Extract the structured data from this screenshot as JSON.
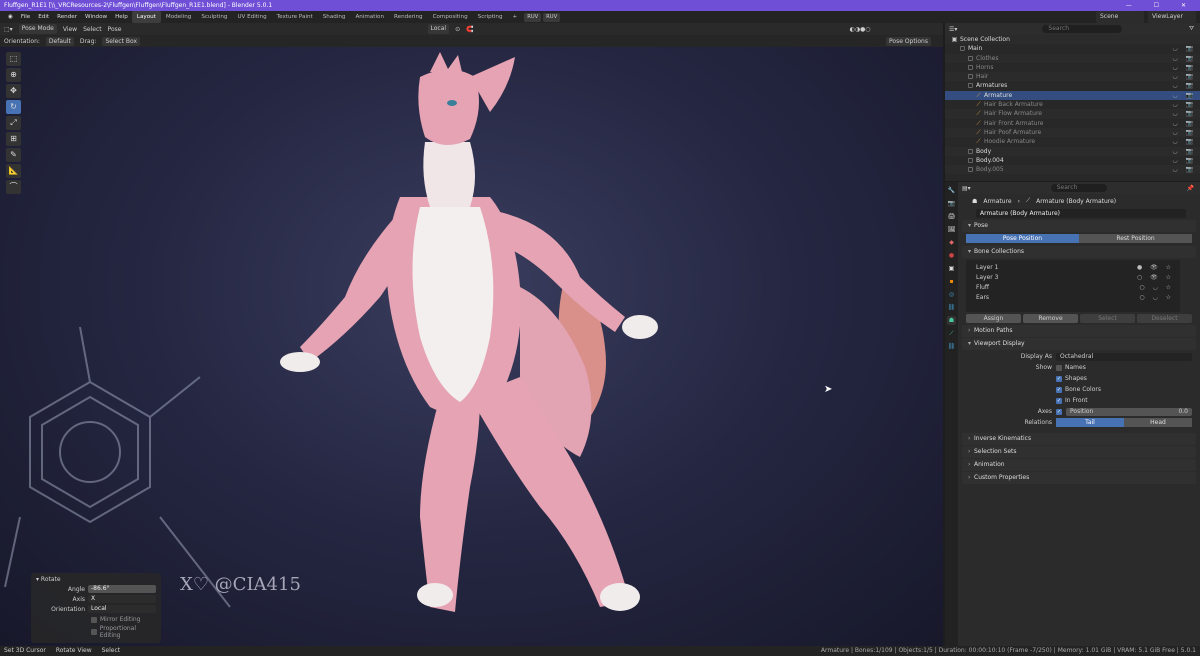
{
  "window": {
    "title": "Fluffgen_R1E1 [\\\\_VRCResources-2\\Fluffgen\\Fluffgen\\Fluffgen_R1E1.blend] - Blender 5.0.1",
    "controls": "—  ☐  ✕"
  },
  "menu": {
    "items": [
      "File",
      "Edit",
      "Render",
      "Window",
      "Help"
    ],
    "workspaces": [
      "Layout",
      "Modeling",
      "Sculpting",
      "UV Editing",
      "Texture Paint",
      "Shading",
      "Animation",
      "Rendering",
      "Compositing",
      "Scripting"
    ],
    "ruv1": "RUV",
    "ruv2": "RUV",
    "scene": "Scene",
    "view_layer": "ViewLayer"
  },
  "viewport_header": {
    "mode": "Pose Mode",
    "view": "View",
    "select": "Select",
    "pose": "Pose",
    "orientation_global": "Local",
    "pose_options": "Pose Options"
  },
  "tool_settings": {
    "orientation_label": "Orientation:",
    "orientation_value": "Default",
    "drag_label": "Drag:",
    "drag_value": "Select Box"
  },
  "rotate_panel": {
    "title": "Rotate",
    "angle_label": "Angle",
    "angle_value": "-86.6°",
    "axis_label": "Axis",
    "axis_value": "X",
    "orientation_label": "Orientation",
    "orientation_value": "Local",
    "mirror": "Mirror Editing",
    "proportional": "Proportional Editing"
  },
  "watermark": "X♡ @CIA415",
  "outliner": {
    "search_placeholder": "Search",
    "rows": [
      {
        "name": "Scene Collection",
        "indent": 0,
        "dim": false
      },
      {
        "name": "Main",
        "indent": 1,
        "dim": false
      },
      {
        "name": "Clothes",
        "indent": 2,
        "dim": true
      },
      {
        "name": "Horns",
        "indent": 2,
        "dim": true
      },
      {
        "name": "Hair",
        "indent": 2,
        "dim": true
      },
      {
        "name": "Armatures",
        "indent": 2,
        "dim": false
      },
      {
        "name": "Armature",
        "indent": 3,
        "dim": false,
        "sel": true
      },
      {
        "name": "Hair Back Armature",
        "indent": 3,
        "dim": true
      },
      {
        "name": "Hair Flow Armature",
        "indent": 3,
        "dim": true
      },
      {
        "name": "Hair Front Armature",
        "indent": 3,
        "dim": true
      },
      {
        "name": "Hair Poof Armature",
        "indent": 3,
        "dim": true
      },
      {
        "name": "Hoodie Armature",
        "indent": 3,
        "dim": true
      },
      {
        "name": "Body",
        "indent": 2,
        "dim": false
      },
      {
        "name": "Body.004",
        "indent": 2,
        "dim": false
      },
      {
        "name": "Body.005",
        "indent": 2,
        "dim": true
      }
    ]
  },
  "properties": {
    "search_placeholder": "Search",
    "crumb_object": "Armature",
    "crumb_data": "Armature (Body Armature)",
    "data_name": "Armature (Body Armature)",
    "pose_header": "Pose",
    "pose_position": "Pose Position",
    "rest_position": "Rest Position",
    "bone_collections_header": "Bone Collections",
    "bone_collections": [
      "Layer 1",
      "Layer 3",
      "Fluff",
      "Ears"
    ],
    "assign": "Assign",
    "remove": "Remove",
    "select": "Select",
    "deselect": "Deselect",
    "motion_paths": "Motion Paths",
    "viewport_display": "Viewport Display",
    "display_as_label": "Display As",
    "display_as_value": "Octahedral",
    "show_label": "Show",
    "names": "Names",
    "shapes": "Shapes",
    "bone_colors": "Bone Colors",
    "in_front": "In Front",
    "axes_label": "Axes",
    "position_label": "Position",
    "position_value": "0.0",
    "relations_label": "Relations",
    "tail": "Tail",
    "head": "Head",
    "inverse_kinematics": "Inverse Kinematics",
    "selection_sets": "Selection Sets",
    "animation": "Animation",
    "custom_properties": "Custom Properties"
  },
  "status": {
    "set_cursor": "Set 3D Cursor",
    "rotate_view": "Rotate View",
    "select": "Select",
    "right": "Armature | Bones:1/109 | Objects:1/5 | Duration: 00:00:10:10 (Frame -7/250) | Memory: 1.01 GiB | VRAM: 5.1 GiB Free | 5.0.1"
  },
  "colors": {
    "title_bar": "#6f4fd6",
    "accent": "#4772b3",
    "fur_pink": "#e9a6b4",
    "fur_white": "#f2eeee"
  }
}
